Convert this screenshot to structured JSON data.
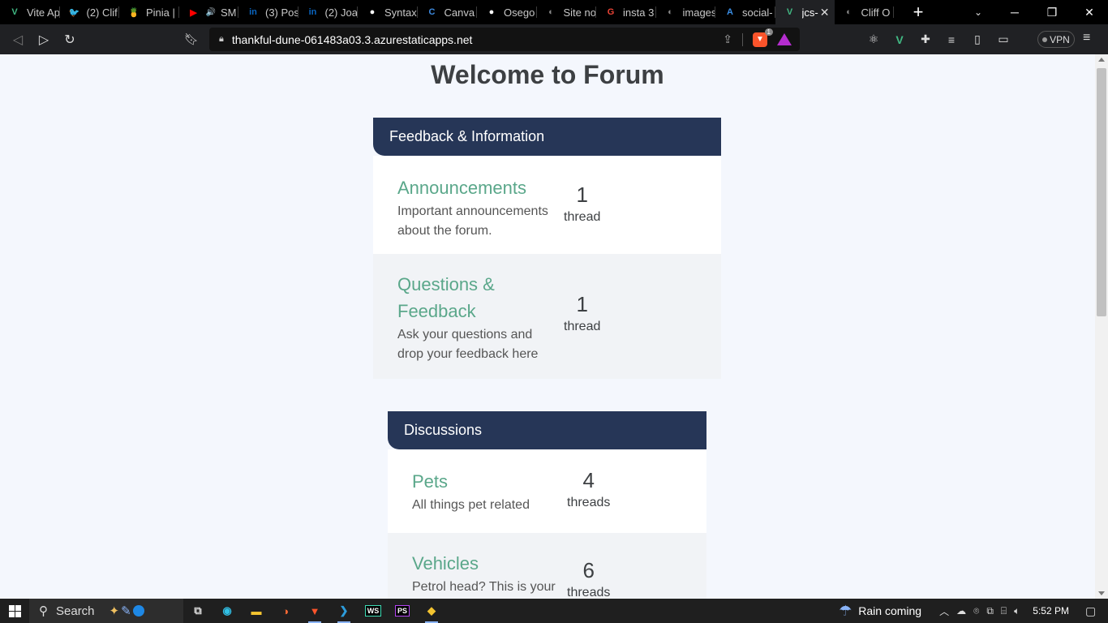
{
  "browser": {
    "tabs": [
      {
        "label": "Vite Ap",
        "icon": "vue-icon",
        "color": "#41b883",
        "glyph": "V"
      },
      {
        "label": "(2) Clif",
        "icon": "twitter-icon",
        "color": "#1d9bf0",
        "glyph": "🐦"
      },
      {
        "label": "Pinia |",
        "icon": "pinia-icon",
        "color": "#f4d03f",
        "glyph": "🍍"
      },
      {
        "label": "SM",
        "icon": "youtube-icon",
        "color": "#ff0000",
        "glyph": "▶",
        "audio": "🔊"
      },
      {
        "label": "(3) Pos",
        "icon": "linkedin-icon",
        "color": "#0a66c2",
        "glyph": "in"
      },
      {
        "label": "(2) Joa",
        "icon": "linkedin-icon",
        "color": "#0a66c2",
        "glyph": "in"
      },
      {
        "label": "Syntax",
        "icon": "github-icon",
        "color": "#ffffff",
        "glyph": "●"
      },
      {
        "label": "Canva",
        "icon": "canva-icon",
        "color": "#3d8ae0",
        "glyph": "C"
      },
      {
        "label": "Osego",
        "icon": "github-icon",
        "color": "#ffffff",
        "glyph": "●"
      },
      {
        "label": "Site no",
        "icon": "globe-icon",
        "color": "#888888",
        "glyph": "◐"
      },
      {
        "label": "insta 3",
        "icon": "google-icon",
        "color": "#ea4335",
        "glyph": "G"
      },
      {
        "label": "images",
        "icon": "globe-icon",
        "color": "#888888",
        "glyph": "◐"
      },
      {
        "label": "social-",
        "icon": "azure-icon",
        "color": "#3a8ee6",
        "glyph": "A"
      },
      {
        "label": "jcs-",
        "icon": "vue-icon",
        "color": "#41b883",
        "glyph": "V",
        "active": true
      },
      {
        "label": "Cliff O",
        "icon": "globe-icon",
        "color": "#888888",
        "glyph": "◐"
      }
    ],
    "url": "thankful-dune-061483a03.3.azurestaticapps.net",
    "brave_badge": "1",
    "vpn_label": "VPN"
  },
  "page": {
    "title": "Welcome to Forum",
    "categories": [
      {
        "name": "Feedback & Information",
        "forums": [
          {
            "name": "Announcements",
            "description": "Important announcements about the forum.",
            "count": "1",
            "unit": "thread"
          },
          {
            "name": "Questions & Feedback",
            "description": "Ask your questions and drop your feedback here",
            "count": "1",
            "unit": "thread"
          }
        ]
      },
      {
        "name": "Discussions",
        "forums": [
          {
            "name": "Pets",
            "description": "All things pet related",
            "count": "4",
            "unit": "threads"
          },
          {
            "name": "Vehicles",
            "description": "Petrol head? This is your",
            "count": "6",
            "unit": "threads"
          }
        ]
      }
    ]
  },
  "taskbar": {
    "search_label": "Search",
    "weather_text": "Rain coming",
    "time": "5:52 PM"
  }
}
